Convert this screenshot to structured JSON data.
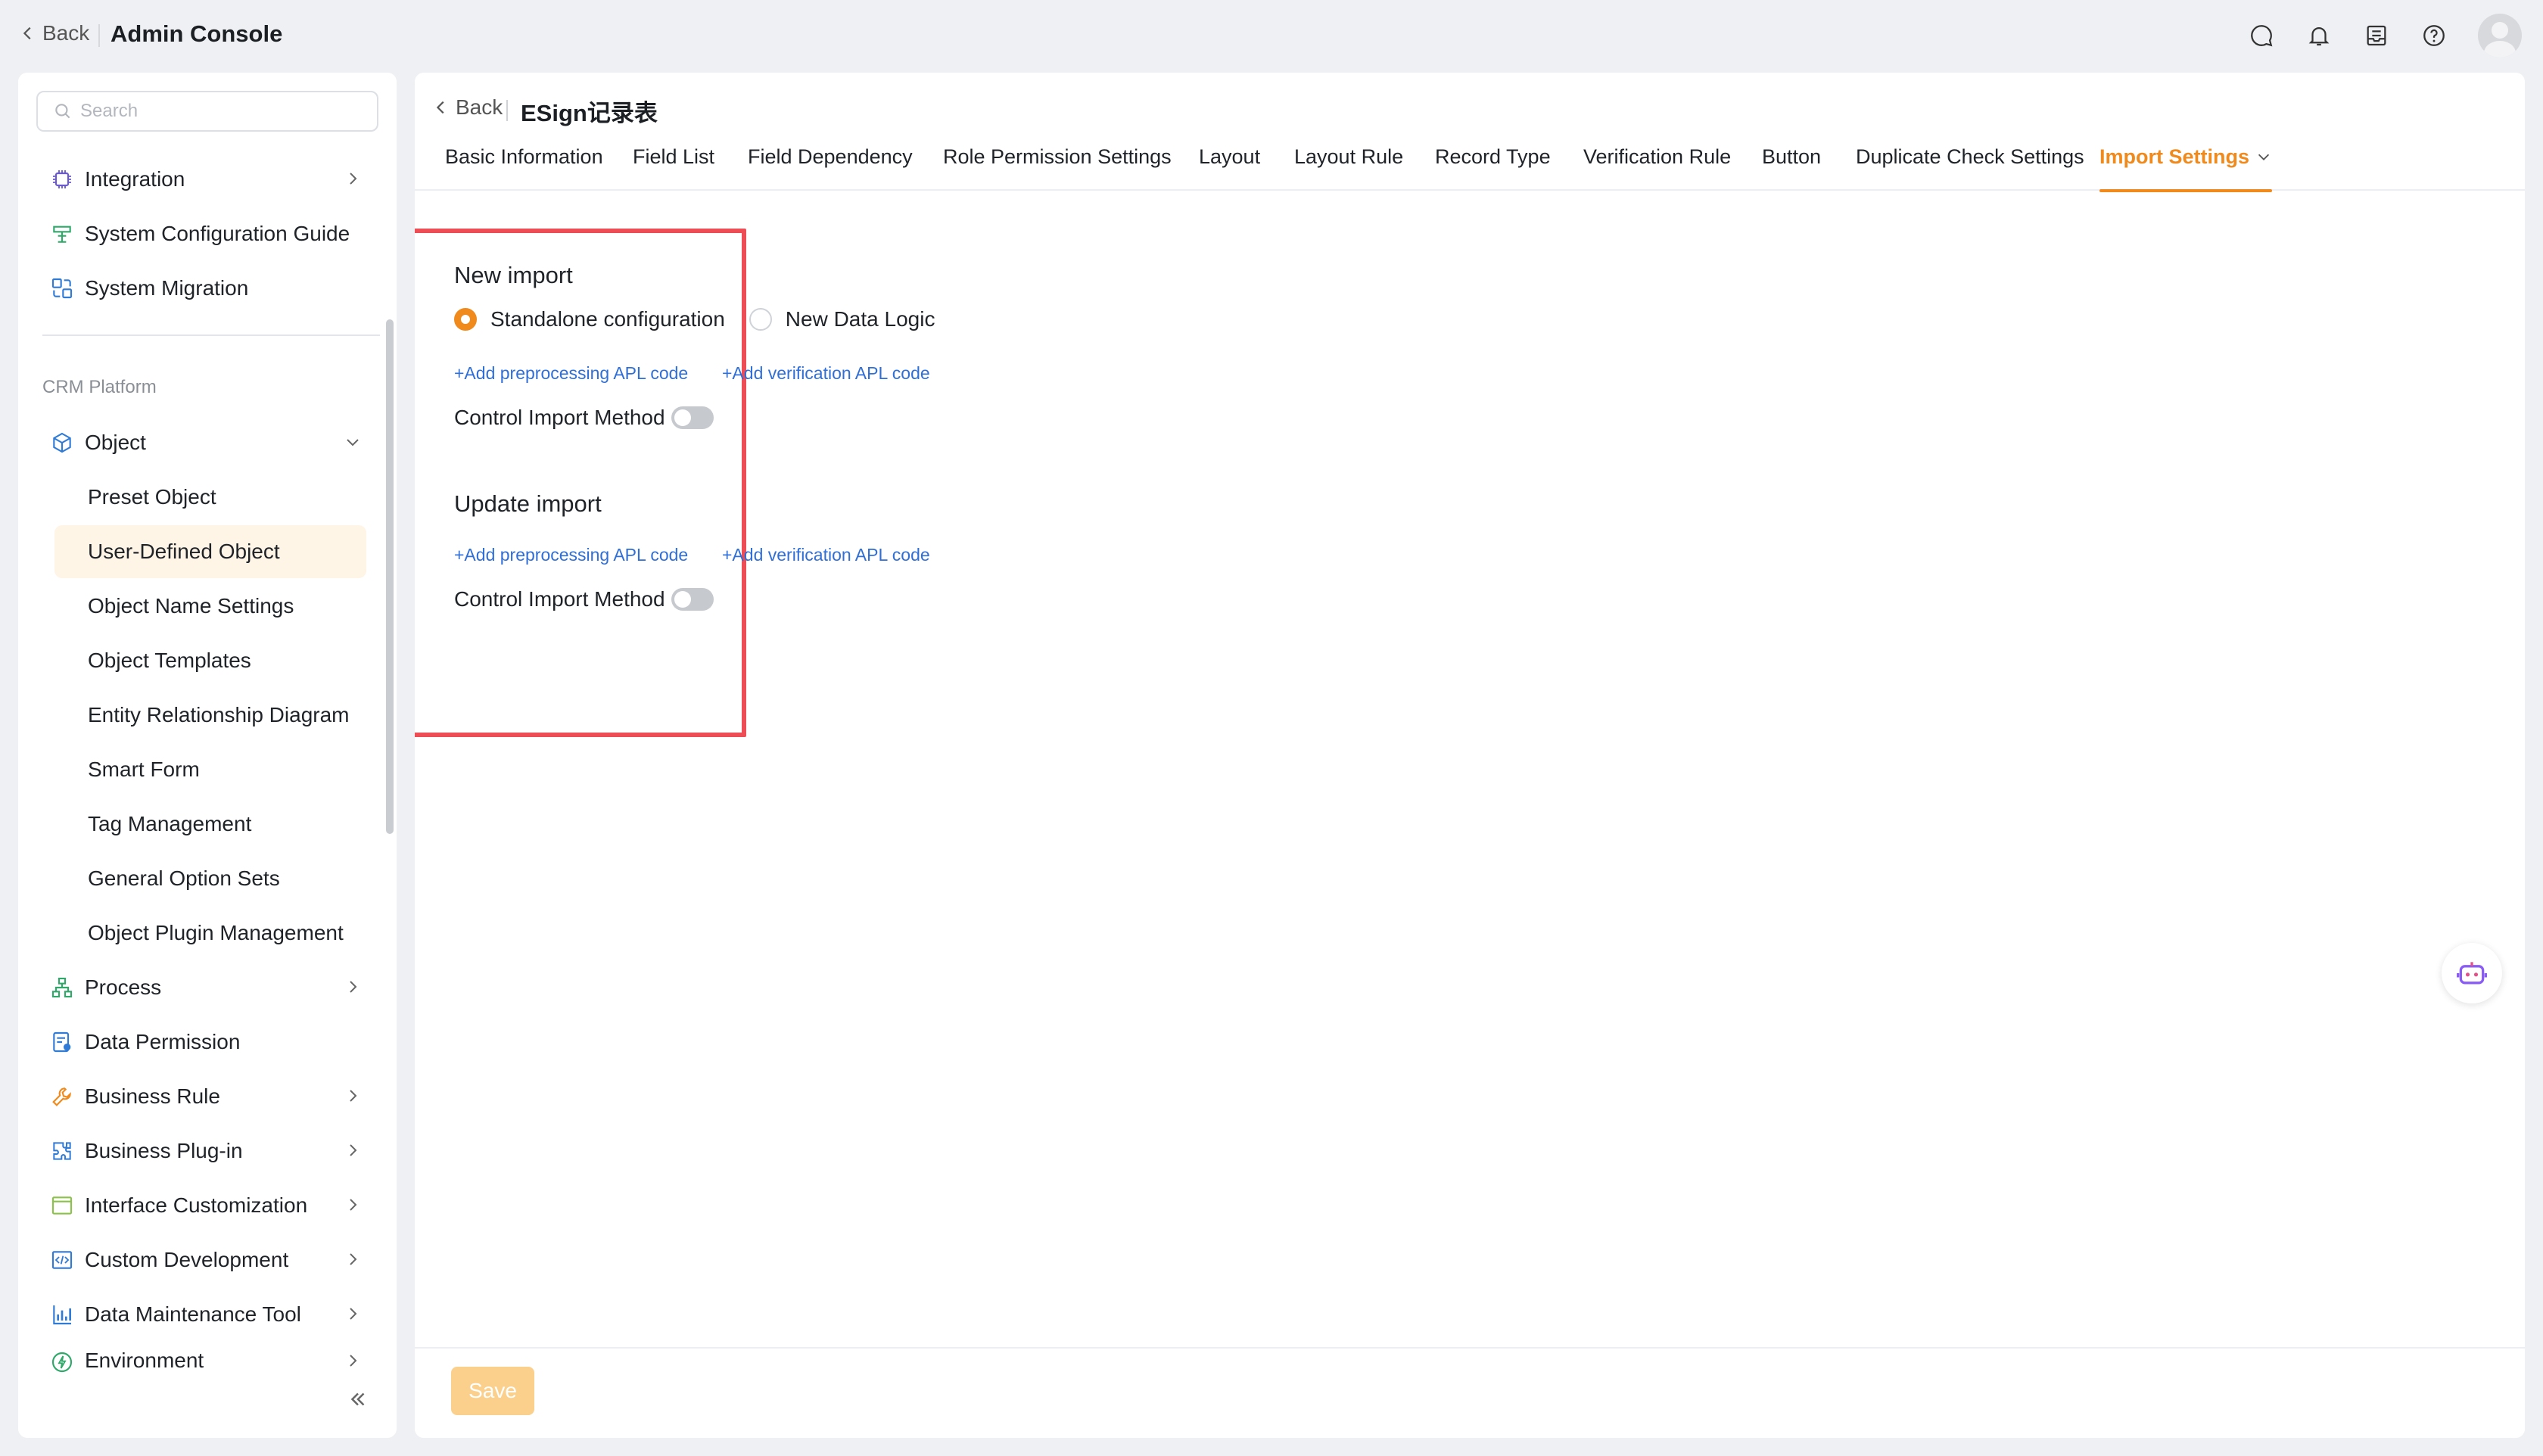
{
  "topbar": {
    "back_label": "Back",
    "title": "Admin Console"
  },
  "sidebar": {
    "search_placeholder": "Search",
    "top_items": [
      {
        "label": "Integration",
        "icon": "integration-icon"
      },
      {
        "label": "System Configuration Guide",
        "icon": "guide-icon"
      },
      {
        "label": "System Migration",
        "icon": "migration-icon"
      }
    ],
    "section_label": "CRM Platform",
    "object_label": "Object",
    "object_children": [
      "Preset Object",
      "User-Defined Object",
      "Object Name Settings",
      "Object Templates",
      "Entity Relationship Diagram",
      "Smart Form",
      "Tag Management",
      "General Option Sets",
      "Object Plugin Management"
    ],
    "bottom_items": [
      {
        "label": "Process",
        "icon": "process-icon"
      },
      {
        "label": "Data Permission",
        "icon": "data-permission-icon"
      },
      {
        "label": "Business Rule",
        "icon": "business-rule-icon"
      },
      {
        "label": "Business Plug-in",
        "icon": "plugin-icon"
      },
      {
        "label": "Interface Customization",
        "icon": "interface-icon"
      },
      {
        "label": "Custom Development",
        "icon": "code-icon"
      },
      {
        "label": "Data Maintenance Tool",
        "icon": "chart-icon"
      },
      {
        "label": "Environment",
        "icon": "environment-icon"
      }
    ]
  },
  "main": {
    "back_label": "Back",
    "object_title": "ESign记录表",
    "tabs": [
      "Basic Information",
      "Field List",
      "Field Dependency",
      "Role Permission Settings",
      "Layout",
      "Layout Rule",
      "Record Type",
      "Verification Rule",
      "Button",
      "Duplicate Check Settings",
      "Import Settings"
    ],
    "active_tab": "Import Settings",
    "new_import": {
      "title": "New import",
      "option_standalone": "Standalone configuration",
      "option_new_logic": "New Data Logic",
      "selected_option": "Standalone configuration",
      "link_preprocessing": "+Add preprocessing APL code",
      "link_verification": "+Add verification APL code",
      "control_label": "Control Import Method"
    },
    "update_import": {
      "title": "Update import",
      "link_preprocessing": "+Add preprocessing APL code",
      "link_verification": "+Add verification APL code",
      "control_label": "Control Import Method"
    },
    "save_label": "Save"
  },
  "colors": {
    "accent": "#f08a1c",
    "link": "#2f6fd6",
    "highlight": "#ef4d56"
  }
}
